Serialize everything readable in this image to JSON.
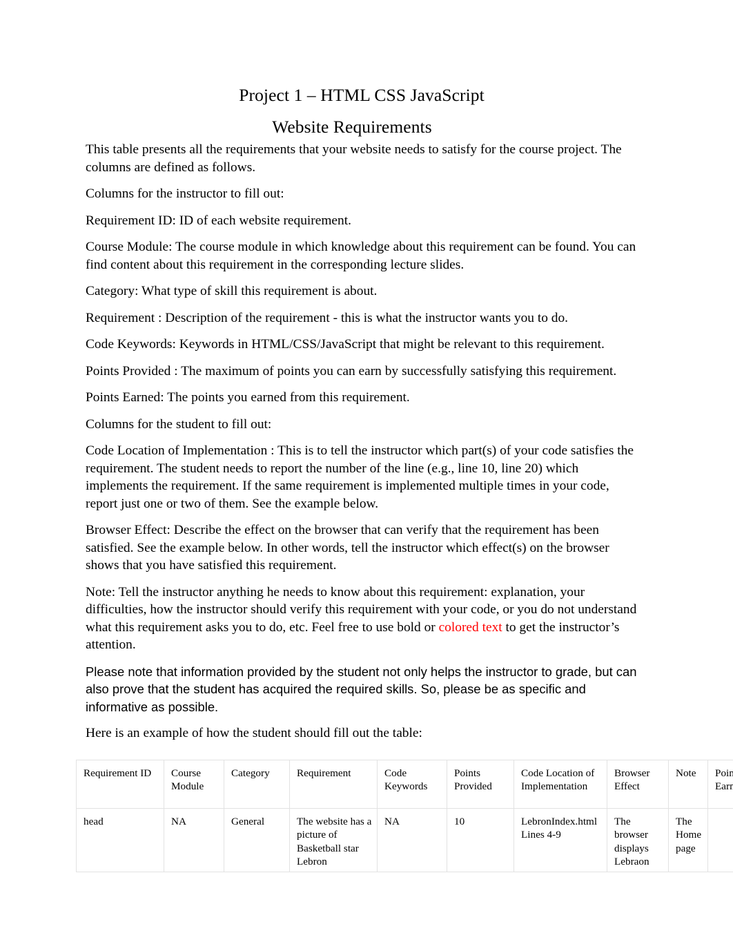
{
  "document": {
    "title": "Project 1 – HTML CSS JavaScript",
    "subtitle": "Website Requirements",
    "paragraphs": [
      "This table presents all the requirements that your website needs to satisfy for the course project. The columns are defined as follows.",
      "Columns for the instructor to fill out:",
      "Requirement ID: ID of each website requirement.",
      "Course Module: The course module in which knowledge about this requirement can be found. You can find content about this requirement in the corresponding lecture slides.",
      "Category: What type of skill this requirement is about.",
      "Requirement : Description of the requirement - this is what the instructor wants you to do.",
      "Code Keywords: Keywords in HTML/CSS/JavaScript that might be relevant to this requirement.",
      "Points Provided : The maximum of points you can earn by successfully satisfying this requirement.",
      "Points Earned: The points you earned from this requirement.",
      "Columns for the student to fill out:",
      "Code Location of Implementation : This is to tell the instructor which part(s) of your code satisfies the requirement. The student needs to report the number of the line (e.g., line 10, line 20) which implements the requirement. If the same requirement is implemented multiple times in your code, report just one or two of them. See the example below.",
      "Browser Effect: Describe the effect on the browser that can verify that the requirement has been satisfied. See the example below. In other words, tell the instructor which effect(s) on the browser shows that you have satisfied this requirement."
    ],
    "note_paragraph": {
      "before_red": "Note: Tell the instructor anything he needs to know about this requirement: explanation, your difficulties, how the instructor should verify this requirement with your code, or you do not understand what this requirement asks you to do, etc. Feel free to use   bold or ",
      "red_text": "colored text",
      "after_red": " to get the instructor’s attention."
    },
    "please_note_paragraph": "Please note that information provided by the student not only helps the instructor to grade, but can also prove that the student has acquired the required skills. So, please be as specific and informative as possible.",
    "example_intro": "Here is an example of how the student should fill out the table:",
    "colors": {
      "red_accent": "#FF0000",
      "text": "#000000",
      "table_border": "#E2E2E2",
      "page_background": "#FFFFFF"
    }
  },
  "table": {
    "headers": [
      "Requirement ID",
      "Course Module",
      "Category",
      "Requirement",
      "Code Keywords",
      "Points Provided",
      "Code Location of Implementation",
      "Browser Effect",
      "Note",
      "Points Earned"
    ],
    "rows": [
      [
        "head",
        "NA",
        "General",
        "The website has a picture of Basketball star Lebron",
        "NA",
        "10",
        "LebronIndex.html\nLines 4-9",
        "The browser displays Lebraon",
        "The Home page",
        ""
      ]
    ]
  }
}
